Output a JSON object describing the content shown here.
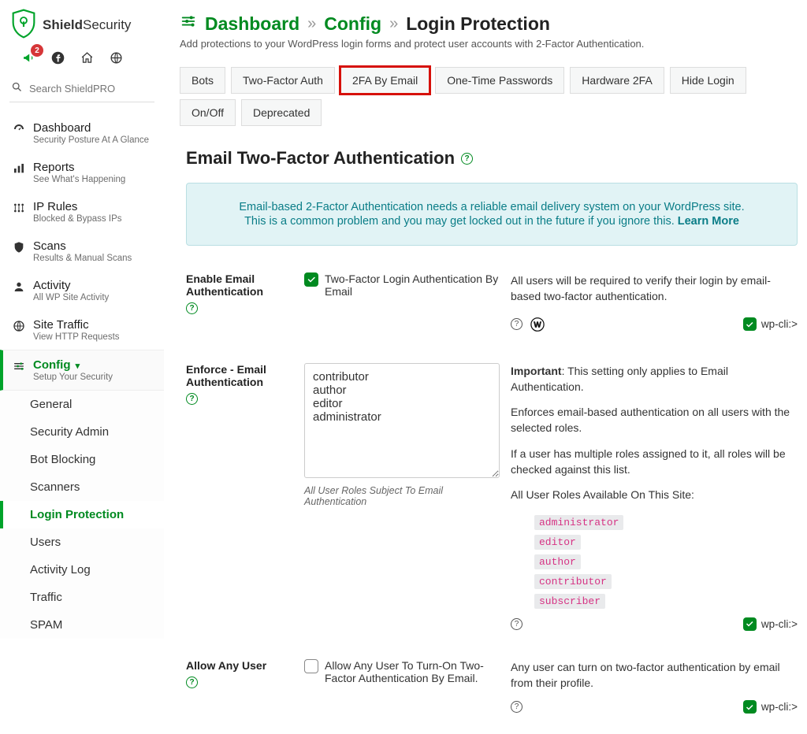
{
  "brand": {
    "bold": "Shield",
    "light": "Security"
  },
  "quick": {
    "badge": "2"
  },
  "search": {
    "placeholder": "Search ShieldPRO"
  },
  "sidebar": [
    {
      "label": "Dashboard",
      "sub": "Security Posture At A Glance"
    },
    {
      "label": "Reports",
      "sub": "See What's Happening"
    },
    {
      "label": "IP Rules",
      "sub": "Blocked & Bypass IPs"
    },
    {
      "label": "Scans",
      "sub": "Results & Manual Scans"
    },
    {
      "label": "Activity",
      "sub": "All WP Site Activity"
    },
    {
      "label": "Site Traffic",
      "sub": "View HTTP Requests"
    },
    {
      "label": "Config",
      "sub": "Setup Your Security"
    }
  ],
  "configSub": [
    "General",
    "Security Admin",
    "Bot Blocking",
    "Scanners",
    "Login Protection",
    "Users",
    "Activity Log",
    "Traffic",
    "SPAM"
  ],
  "crumb": {
    "a": "Dashboard",
    "b": "Config",
    "c": "Login Protection"
  },
  "desc": "Add protections to your WordPress login forms and protect user accounts with 2-Factor Authentication.",
  "tabs": [
    "Bots",
    "Two-Factor Auth",
    "2FA By Email",
    "One-Time Passwords",
    "Hardware 2FA",
    "Hide Login",
    "On/Off",
    "Deprecated"
  ],
  "h2": "Email Two-Factor Authentication",
  "info": {
    "l1": "Email-based 2-Factor Authentication needs a reliable email delivery system on your WordPress site.",
    "l2": "This is a common problem and you may get locked out in the future if you ignore this. ",
    "link": "Learn More"
  },
  "rows": {
    "r1": {
      "label": "Enable Email Authentication",
      "ck": "Two-Factor Login Authentication By Email",
      "desc": "All users will be required to verify their login by email-based two-factor authentication."
    },
    "r2": {
      "label": "Enforce - Email Authentication",
      "ta": "contributor\nauthor\neditor\nadministrator",
      "hint": "All User Roles Subject To Email Authentication",
      "d1": "Important",
      "d1b": ": This setting only applies to Email Authentication.",
      "d2": "Enforces email-based authentication on all users with the selected roles.",
      "d3": "If a user has multiple roles assigned to it, all roles will be checked against this list.",
      "d4": "All User Roles Available On This Site:",
      "roles": [
        "administrator",
        "editor",
        "author",
        "contributor",
        "subscriber"
      ]
    },
    "r3": {
      "label": "Allow Any User",
      "ck": "Allow Any User To Turn-On Two-Factor Authentication By Email.",
      "desc": "Any user can turn on two-factor authentication by email from their profile."
    }
  },
  "wpcli": "wp-cli:>"
}
